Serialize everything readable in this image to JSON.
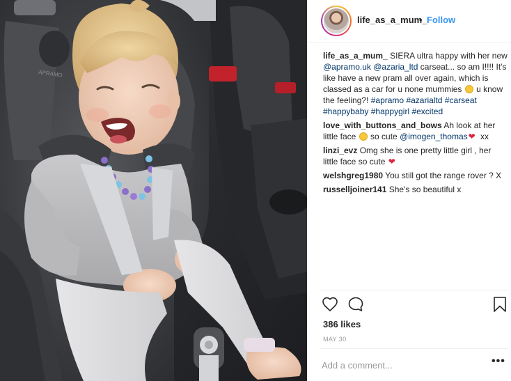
{
  "post": {
    "author": {
      "username": "life_as_a_mum_",
      "follow_label": "Follow",
      "separator": "•"
    },
    "caption": {
      "username": "life_as_a_mum_",
      "text_1": " SIERA ultra happy with her new ",
      "tag_1": "@apramo.uk",
      "text_2": " ",
      "tag_2": "@azaria_ltd",
      "text_3": " carseat... so am I!!!! It's like have a new pram all over again, which is classed as a car for u none mummies ",
      "text_4": " u know the feeling?! ",
      "hashtags": [
        "#apramo",
        "#azarialtd",
        "#carseat",
        "#happybaby",
        "#happygirl",
        "#excited"
      ]
    },
    "comments": [
      {
        "username": "love_with_buttons_and_bows",
        "text_1": " Ah look at her little face ",
        "text_2": " so cute ",
        "tag": "@imogen_thomas",
        "text_3": " xx"
      },
      {
        "username": "linzi_evz",
        "text_1": " Omg she is one pretty little girl , her little face so cute "
      },
      {
        "username": "welshgreg1980",
        "text_1": " You still got the range rover ? X"
      },
      {
        "username": "russelljoiner141",
        "text_1": " She's so beautiful x"
      }
    ],
    "likes_label": "386 likes",
    "date_label": "MAY 30",
    "add_comment_placeholder": "Add a comment...",
    "more_label": "•••",
    "icons": {
      "like": "heart-outline-icon",
      "comment": "speech-bubble-icon",
      "save": "bookmark-icon"
    },
    "colors": {
      "link": "#3897f0",
      "tag": "#003569",
      "text": "#262626",
      "muted": "#999999"
    }
  }
}
